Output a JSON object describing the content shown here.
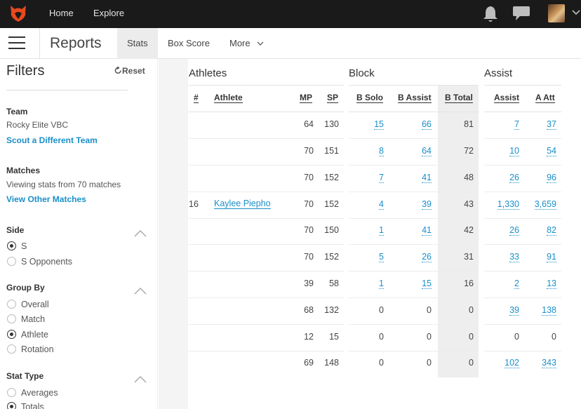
{
  "topbar": {
    "nav": [
      "Home",
      "Explore"
    ]
  },
  "subbar": {
    "title": "Reports",
    "tabs": [
      "Stats",
      "Box Score",
      "More"
    ]
  },
  "sidebar": {
    "title": "Filters",
    "reset": "Reset",
    "team": {
      "label": "Team",
      "value": "Rocky Elite VBC",
      "link": "Scout a Different Team"
    },
    "matches": {
      "label": "Matches",
      "value": "Viewing stats from 70 matches",
      "link": "View Other Matches"
    },
    "side": {
      "label": "Side",
      "options": [
        "S",
        "S Opponents"
      ],
      "selected": "S"
    },
    "group_by": {
      "label": "Group By",
      "options": [
        "Overall",
        "Match",
        "Athlete",
        "Rotation"
      ],
      "selected": "Athlete"
    },
    "stat_type": {
      "label": "Stat Type",
      "options": [
        "Averages",
        "Totals"
      ],
      "selected": "Totals"
    }
  },
  "table": {
    "groups": [
      "Athletes",
      "Block",
      "Assist"
    ],
    "headers": [
      "#",
      "Athlete",
      "MP",
      "SP",
      "B Solo",
      "B Assist",
      "B Total",
      "Assist",
      "A Att"
    ],
    "rows": [
      [
        "",
        "",
        "64",
        "130",
        "15",
        "66",
        "81",
        "7",
        "37"
      ],
      [
        "",
        "",
        "70",
        "151",
        "8",
        "64",
        "72",
        "10",
        "54"
      ],
      [
        "",
        "",
        "70",
        "152",
        "7",
        "41",
        "48",
        "26",
        "96"
      ],
      [
        "16",
        "Kaylee Piepho",
        "70",
        "152",
        "4",
        "39",
        "43",
        "1,330",
        "3,659"
      ],
      [
        "",
        "",
        "70",
        "150",
        "1",
        "41",
        "42",
        "26",
        "82"
      ],
      [
        "",
        "",
        "70",
        "152",
        "5",
        "26",
        "31",
        "33",
        "91"
      ],
      [
        "",
        "",
        "39",
        "58",
        "1",
        "15",
        "16",
        "2",
        "13"
      ],
      [
        "",
        "",
        "68",
        "132",
        "0",
        "0",
        "0",
        "39",
        "138"
      ],
      [
        "",
        "",
        "12",
        "15",
        "0",
        "0",
        "0",
        "0",
        "0"
      ],
      [
        "",
        "",
        "69",
        "148",
        "0",
        "0",
        "0",
        "102",
        "343"
      ]
    ]
  },
  "colors": {
    "accent": "#1a8fc9",
    "topbar": "#1a1a1a",
    "logo": "#e8491d"
  },
  "icons": [
    "logo-icon",
    "bell-icon",
    "chat-icon",
    "menu-icon",
    "refresh-icon",
    "chevron-up-icon",
    "chevron-down-icon"
  ]
}
